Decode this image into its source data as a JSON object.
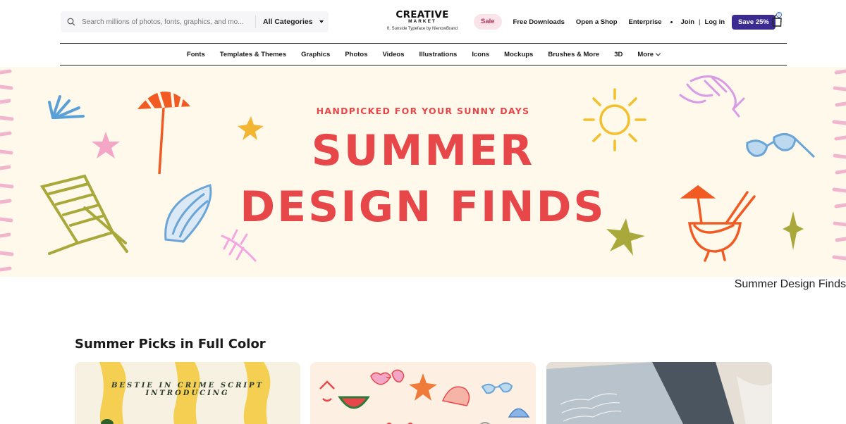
{
  "search": {
    "placeholder": "Search millions of photos, fonts, graphics, and mo...",
    "category": "All Categories"
  },
  "logo": {
    "main": "CREATIVE",
    "sub": "MARKET",
    "tagline": "ft. Sunside Typeface by NienowBrand"
  },
  "nav": {
    "sale": "Sale",
    "free_downloads": "Free Downloads",
    "open_shop": "Open a Shop",
    "enterprise": "Enterprise",
    "join": "Join",
    "separator": "|",
    "login": "Log in",
    "save": "Save 25%",
    "cart_count": "0"
  },
  "categories": [
    "Fonts",
    "Templates & Themes",
    "Graphics",
    "Photos",
    "Videos",
    "Illustrations",
    "Icons",
    "Mockups",
    "Brushes & More",
    "3D",
    "More"
  ],
  "hero": {
    "eyebrow": "HANDPICKED FOR YOUR SUNNY DAYS",
    "line1": "SUMMER",
    "line2": "DESIGN FINDS",
    "caption": "Summer Design Finds"
  },
  "section": {
    "title": "Summer Picks in Full Color",
    "cards": [
      {
        "text": "BESTIE IN CRIME SCRIPT INTRODUCING"
      },
      {
        "text": ""
      },
      {
        "text": ""
      }
    ]
  },
  "colors": {
    "hero_bg": "#fff9ec",
    "hero_text": "#e8474a",
    "save_btn": "#3b2a8f",
    "sale_pill": "#fbe3ea"
  },
  "icons": [
    "search-icon",
    "chevron-down-icon",
    "bag-icon",
    "umbrella-icon",
    "sun-icon",
    "lobster-icon",
    "sunglasses-icon",
    "beach-chair-icon",
    "shell-icon",
    "starfish-icon",
    "cocktail-icon",
    "palm-leaf-icon"
  ]
}
